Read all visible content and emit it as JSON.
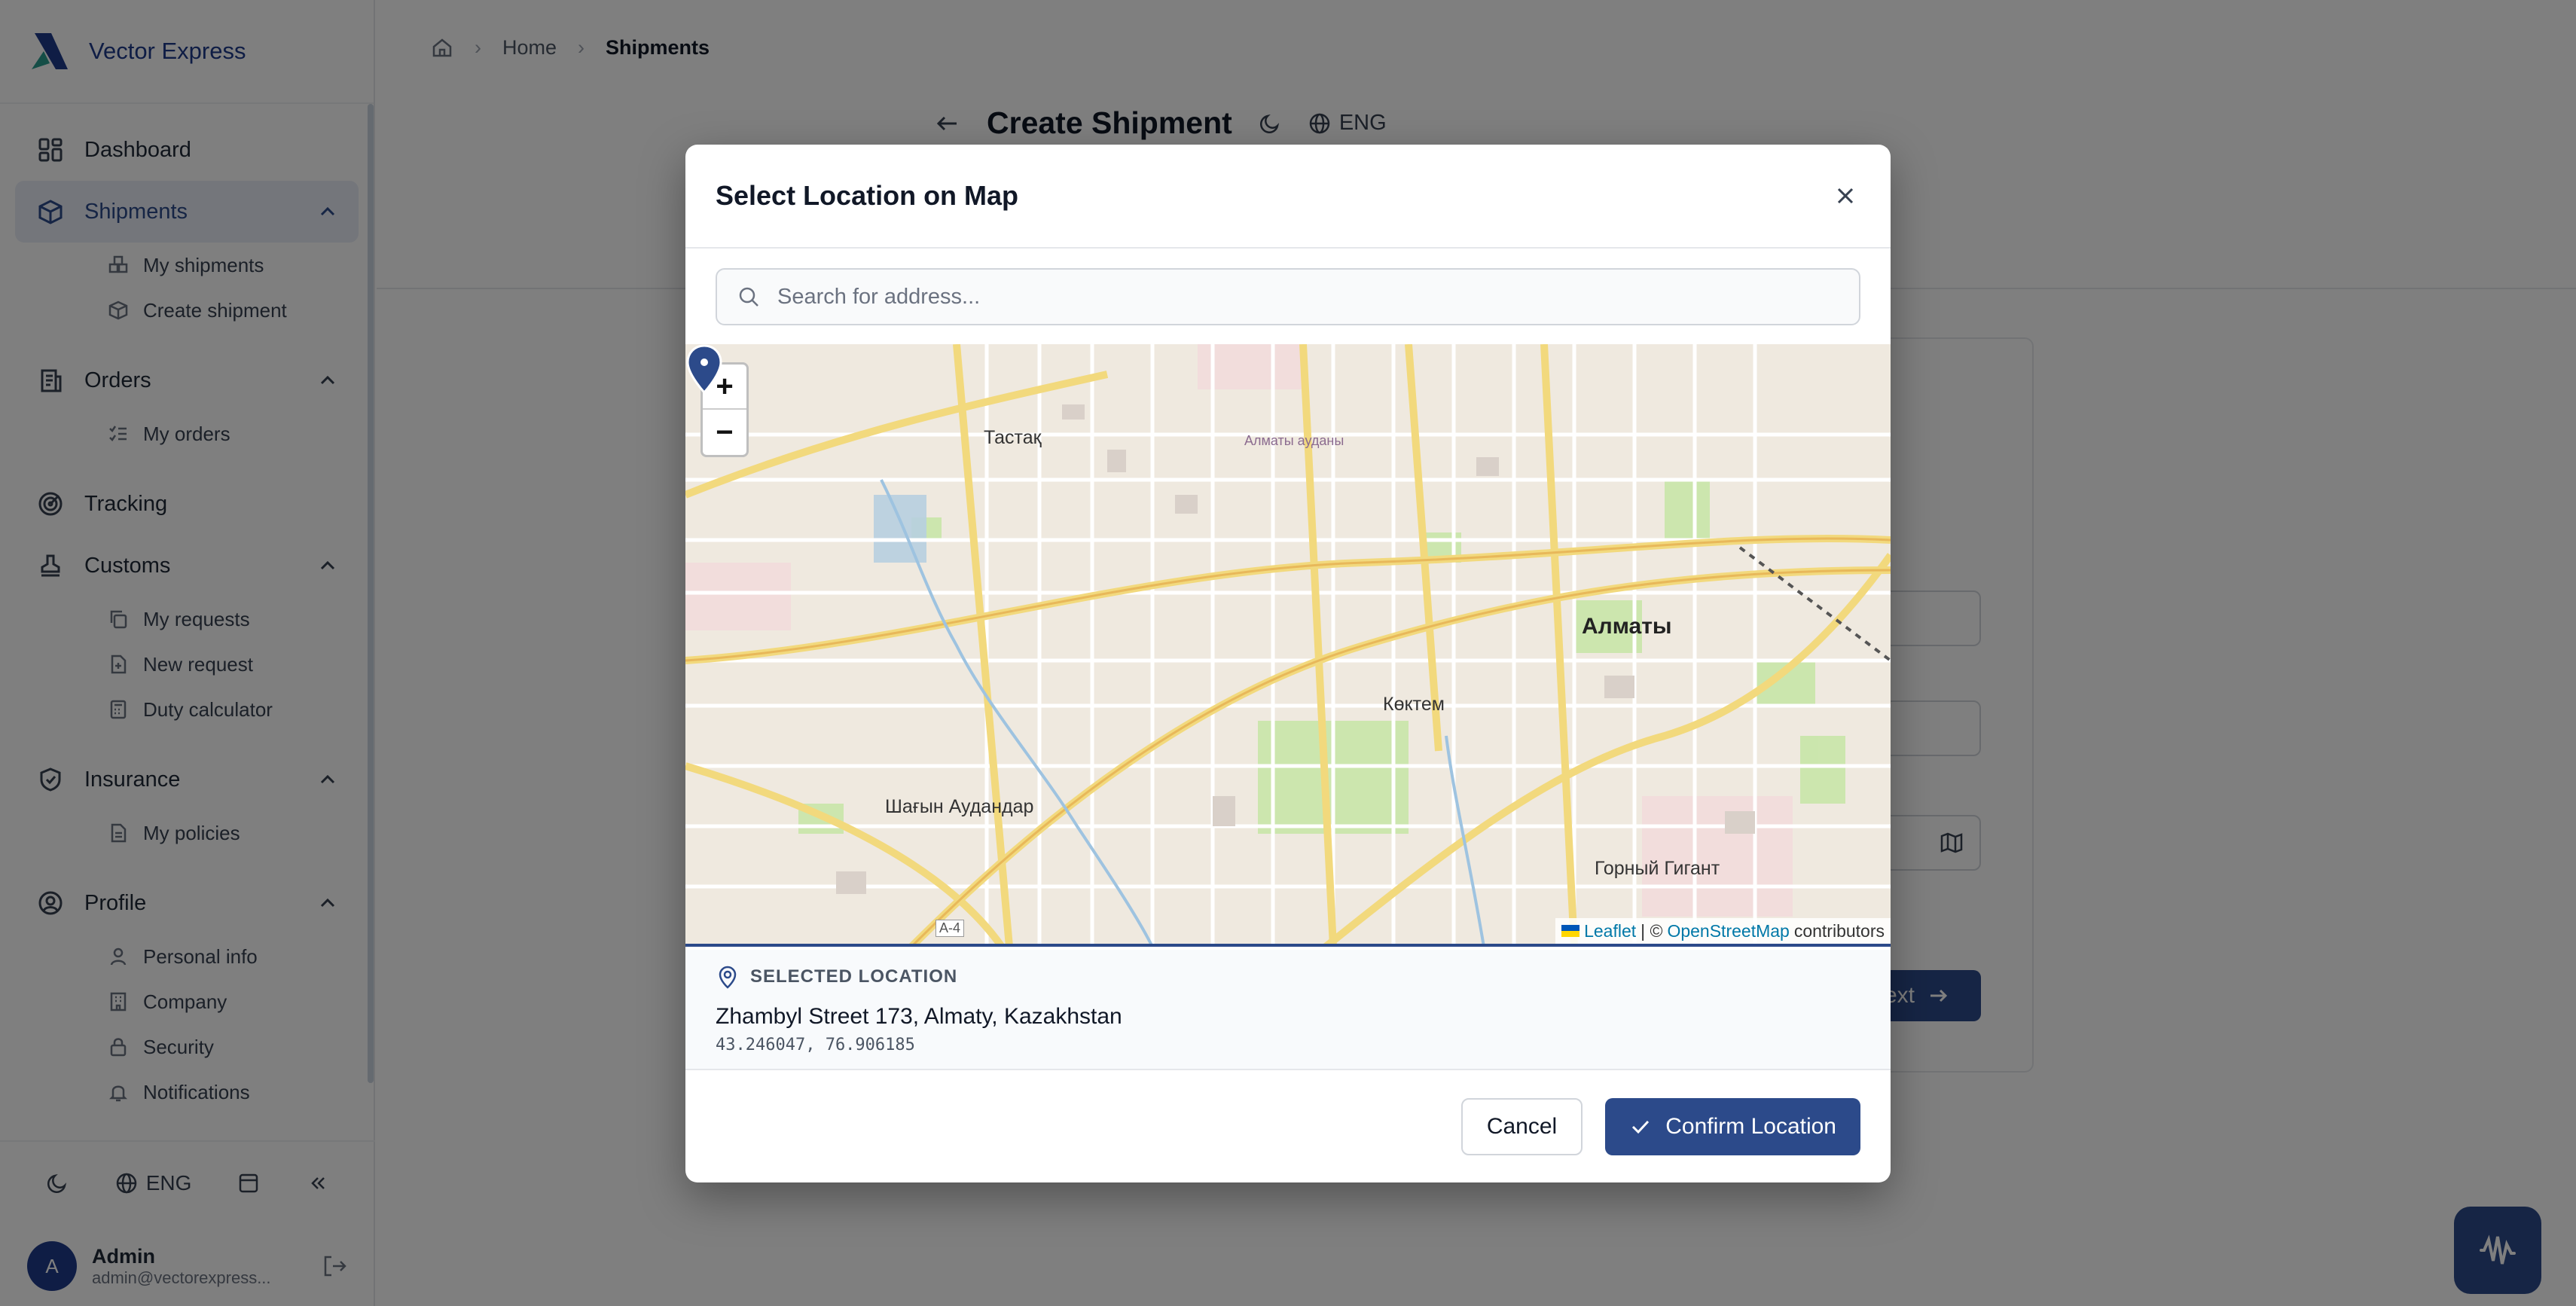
{
  "brand": {
    "name": "Vector Express"
  },
  "sidebar": {
    "items": [
      {
        "label": "Dashboard"
      },
      {
        "label": "Shipments",
        "sub": [
          "My shipments",
          "Create shipment"
        ]
      },
      {
        "label": "Orders",
        "sub": [
          "My orders"
        ]
      },
      {
        "label": "Tracking"
      },
      {
        "label": "Customs",
        "sub": [
          "My requests",
          "New request",
          "Duty calculator"
        ]
      },
      {
        "label": "Insurance",
        "sub": [
          "My policies"
        ]
      },
      {
        "label": "Profile",
        "sub": [
          "Personal info",
          "Company",
          "Security",
          "Notifications"
        ]
      }
    ],
    "language": "ENG",
    "user": {
      "initial": "A",
      "name": "Admin",
      "email": "admin@vectorexpress..."
    }
  },
  "breadcrumb": {
    "home": "Home",
    "current": "Shipments"
  },
  "page": {
    "title": "Create Shipment",
    "language": "ENG",
    "next_label": "ext"
  },
  "modal": {
    "title": "Select Location on Map",
    "search_placeholder": "Search for address...",
    "map": {
      "labels": {
        "tastak": "Тастақ",
        "almaty": "Алматы",
        "koktem": "Көктем",
        "shagyn": "Шағын Аудандар",
        "gorny": "Горный Гигант",
        "district": "Алматы ауданы",
        "a4": "A-4"
      },
      "zoom_in": "+",
      "zoom_out": "−",
      "attribution": {
        "leaflet": "Leaflet",
        "sep": "| ©",
        "osm": "OpenStreetMap",
        "contributors": "contributors"
      }
    },
    "selected": {
      "heading": "SELECTED LOCATION",
      "address": "Zhambyl Street 173, Almaty, Kazakhstan",
      "coords": "43.246047, 76.906185"
    },
    "cancel_label": "Cancel",
    "confirm_label": "Confirm Location"
  },
  "colors": {
    "primary": "#2c4a8a",
    "brand": "#1e3a8a",
    "overlay": "rgba(0,0,0,0.5)"
  }
}
